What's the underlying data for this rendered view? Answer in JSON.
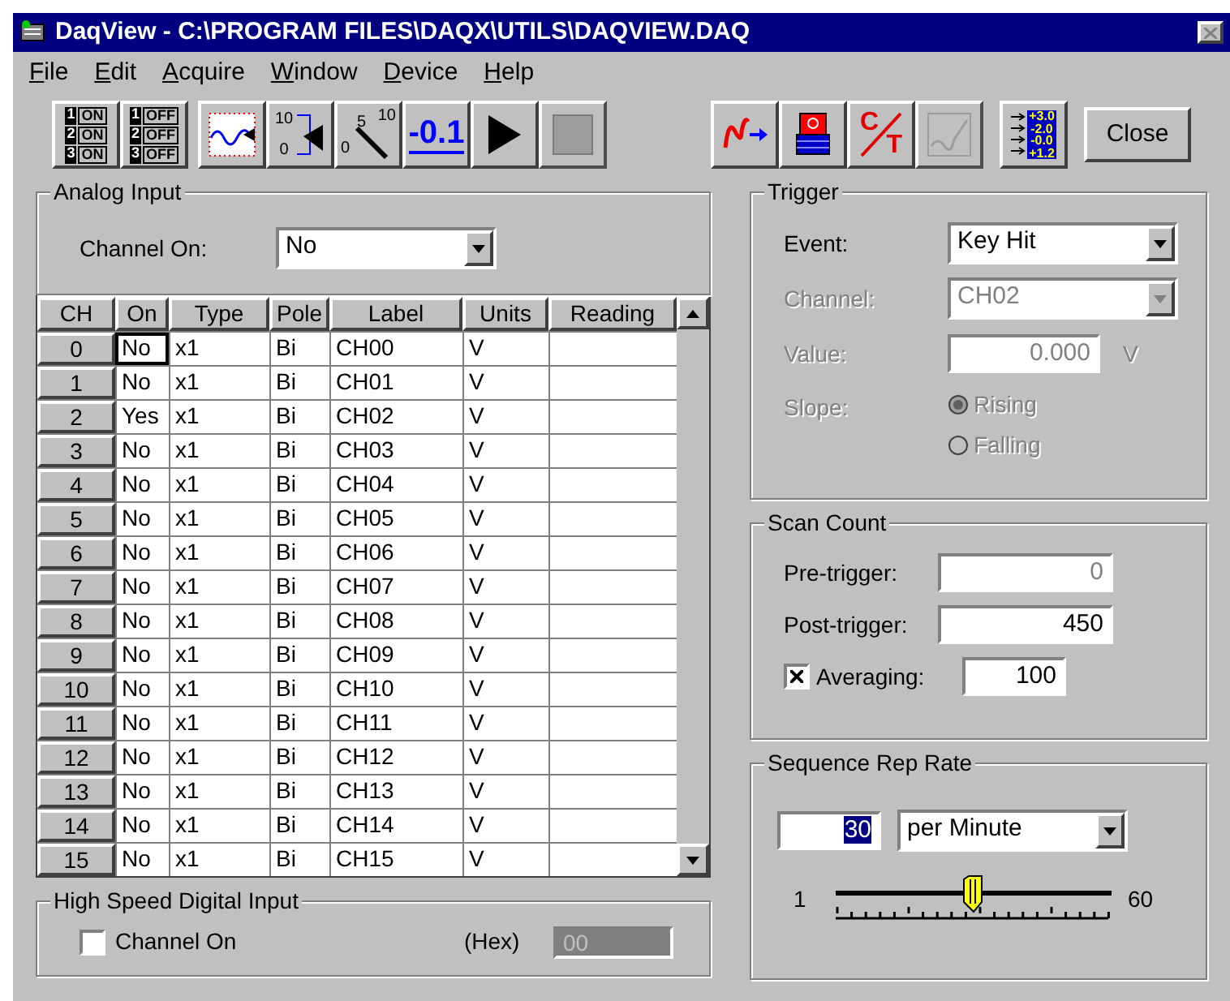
{
  "window": {
    "title": "DaqView - C:\\PROGRAM FILES\\DAQX\\UTILS\\DAQVIEW.DAQ"
  },
  "menu": [
    {
      "label": "File"
    },
    {
      "label": "Edit"
    },
    {
      "label": "Acquire"
    },
    {
      "label": "Window"
    },
    {
      "label": "Device"
    },
    {
      "label": "Help"
    }
  ],
  "toolbar_left": [
    [
      {
        "kind": "switches",
        "rows": [
          {
            "num": "1",
            "text": "ON"
          },
          {
            "num": "2",
            "text": "ON"
          },
          {
            "num": "3",
            "text": "ON"
          }
        ],
        "disabled": false
      },
      {
        "kind": "switches",
        "rows": [
          {
            "num": "1",
            "text": "OFF"
          },
          {
            "num": "2",
            "text": "OFF"
          },
          {
            "num": "3",
            "text": "OFF"
          }
        ],
        "disabled": false
      }
    ],
    [
      {
        "kind": "scope",
        "disabled": false
      },
      {
        "kind": "bargraph",
        "texts": [
          "10",
          "0"
        ],
        "disabled": false
      },
      {
        "kind": "gauge",
        "texts": [
          "5",
          "10",
          "0"
        ],
        "disabled": false
      },
      {
        "kind": "digital",
        "texts": [
          "-0.1"
        ],
        "disabled": false
      },
      {
        "kind": "play",
        "disabled": false
      },
      {
        "kind": "stop",
        "disabled": true
      }
    ]
  ],
  "toolbar_right": [
    [
      {
        "kind": "wave",
        "disabled": false
      },
      {
        "kind": "disk",
        "disabled": false
      },
      {
        "kind": "ct",
        "texts": [
          "C",
          "T"
        ],
        "disabled": false
      },
      {
        "kind": "recorder",
        "disabled": true
      }
    ],
    [
      {
        "kind": "list",
        "texts": [
          "+3.0",
          "-2.0",
          "-0.0",
          "+1.2"
        ],
        "disabled": false
      }
    ]
  ],
  "close_button": {
    "label": "Close"
  },
  "analog_input": {
    "title": "Analog Input",
    "channel_on_label": "Channel On:",
    "channel_on_value": "No"
  },
  "grid": {
    "columns": [
      "CH",
      "On",
      "Type",
      "Pole",
      "Label",
      "Units",
      "Reading"
    ],
    "rows": [
      {
        "ch": "0",
        "on": "No",
        "type": "x1",
        "pole": "Bi",
        "label": "CH00",
        "units": "V",
        "focused": true
      },
      {
        "ch": "1",
        "on": "No",
        "type": "x1",
        "pole": "Bi",
        "label": "CH01",
        "units": "V",
        "focused": false
      },
      {
        "ch": "2",
        "on": "Yes",
        "type": "x1",
        "pole": "Bi",
        "label": "CH02",
        "units": "V",
        "focused": false
      },
      {
        "ch": "3",
        "on": "No",
        "type": "x1",
        "pole": "Bi",
        "label": "CH03",
        "units": "V",
        "focused": false
      },
      {
        "ch": "4",
        "on": "No",
        "type": "x1",
        "pole": "Bi",
        "label": "CH04",
        "units": "V",
        "focused": false
      },
      {
        "ch": "5",
        "on": "No",
        "type": "x1",
        "pole": "Bi",
        "label": "CH05",
        "units": "V",
        "focused": false
      },
      {
        "ch": "6",
        "on": "No",
        "type": "x1",
        "pole": "Bi",
        "label": "CH06",
        "units": "V",
        "focused": false
      },
      {
        "ch": "7",
        "on": "No",
        "type": "x1",
        "pole": "Bi",
        "label": "CH07",
        "units": "V",
        "focused": false
      },
      {
        "ch": "8",
        "on": "No",
        "type": "x1",
        "pole": "Bi",
        "label": "CH08",
        "units": "V",
        "focused": false
      },
      {
        "ch": "9",
        "on": "No",
        "type": "x1",
        "pole": "Bi",
        "label": "CH09",
        "units": "V",
        "focused": false
      },
      {
        "ch": "10",
        "on": "No",
        "type": "x1",
        "pole": "Bi",
        "label": "CH10",
        "units": "V",
        "focused": false
      },
      {
        "ch": "11",
        "on": "No",
        "type": "x1",
        "pole": "Bi",
        "label": "CH11",
        "units": "V",
        "focused": false
      },
      {
        "ch": "12",
        "on": "No",
        "type": "x1",
        "pole": "Bi",
        "label": "CH12",
        "units": "V",
        "focused": false
      },
      {
        "ch": "13",
        "on": "No",
        "type": "x1",
        "pole": "Bi",
        "label": "CH13",
        "units": "V",
        "focused": false
      },
      {
        "ch": "14",
        "on": "No",
        "type": "x1",
        "pole": "Bi",
        "label": "CH14",
        "units": "V",
        "focused": false
      },
      {
        "ch": "15",
        "on": "No",
        "type": "x1",
        "pole": "Bi",
        "label": "CH15",
        "units": "V",
        "focused": false
      }
    ]
  },
  "high_speed": {
    "title": "High Speed Digital Input",
    "checkbox": {
      "label": "Channel On",
      "checked": false
    },
    "hex_label": "(Hex)",
    "hex_value": "00"
  },
  "trigger": {
    "title": "Trigger",
    "event": {
      "label": "Event:",
      "value": "Key Hit",
      "disabled": false
    },
    "channel": {
      "label": "Channel:",
      "value": "CH02",
      "disabled": true
    },
    "value": {
      "label": "Value:",
      "value": "0.000",
      "unit": "V",
      "disabled": true
    },
    "slope": {
      "label": "Slope:",
      "disabled": true,
      "options": [
        {
          "label": "Rising",
          "selected": true
        },
        {
          "label": "Falling",
          "selected": false
        }
      ]
    }
  },
  "scan_count": {
    "title": "Scan Count",
    "pre_trigger": {
      "label": "Pre-trigger:",
      "value": "0",
      "disabled": true
    },
    "post_trigger": {
      "label": "Post-trigger:",
      "value": "450",
      "disabled": false
    },
    "averaging": {
      "label": "Averaging:",
      "checked": true,
      "value": "100"
    }
  },
  "sequence": {
    "title": "Sequence Rep Rate",
    "rate": "30",
    "unit": "per Minute",
    "slider": {
      "min": "1",
      "max": "60",
      "level": 0.49
    }
  }
}
